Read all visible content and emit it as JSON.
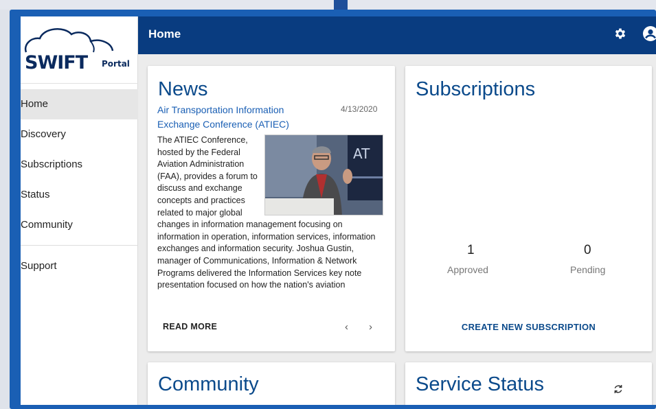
{
  "sidebar": {
    "logo": {
      "word": "SWIFT",
      "sub": "Portal"
    },
    "items": [
      {
        "label": "Home"
      },
      {
        "label": "Discovery"
      },
      {
        "label": "Subscriptions"
      },
      {
        "label": "Status"
      },
      {
        "label": "Community"
      },
      {
        "label": "Support"
      }
    ]
  },
  "header": {
    "title": "Home",
    "icons": [
      "gear-icon",
      "account-circle-icon"
    ]
  },
  "news": {
    "title": "News",
    "headline": "Air Transportation Information Exchange Conference (ATIEC)",
    "date": "4/13/2020",
    "body": "The ATIEC Conference, hosted by the Federal Aviation Administration (FAA), provides a forum to discuss and exchange concepts and practices related to major global changes in information management focusing on information in operation, information services, information exchanges and information security. Joshua Gustin, manager of Communications, Information & Network Programs delivered the Information Services key note presentation focused on how the nation's aviation",
    "read_more": "READ MORE",
    "prev": "‹",
    "next": "›"
  },
  "subscriptions": {
    "title": "Subscriptions",
    "approved_count": "1",
    "approved_label": "Approved",
    "pending_count": "0",
    "pending_label": "Pending",
    "create_label": "CREATE NEW SUBSCRIPTION"
  },
  "community": {
    "title": "Community"
  },
  "service_status": {
    "title": "Service Status",
    "refresh_icon": "refresh-icon"
  },
  "colors": {
    "header_bg": "#093c80",
    "accent": "#0b4a8b",
    "link": "#1a5fb4",
    "frame": "#1a5fb4"
  }
}
